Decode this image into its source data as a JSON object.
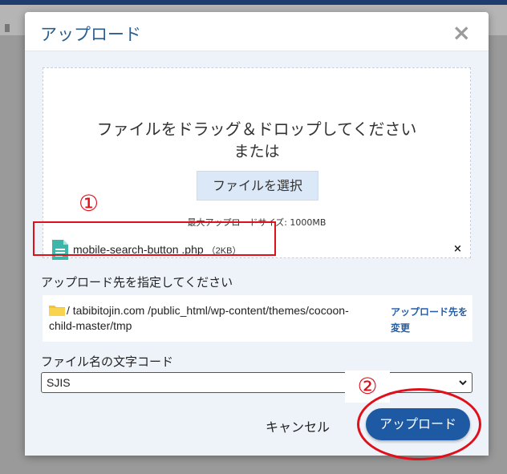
{
  "dialog": {
    "title": "アップロード",
    "close_symbol": "×"
  },
  "dropzone": {
    "instruction": "ファイルをドラッグ＆ドロップしてください",
    "or_text": "または",
    "select_button": "ファイルを選択",
    "max_size": "最大アップロードサイズ: 1000MB"
  },
  "file": {
    "name": "mobile-search-button .php",
    "size": "（2KB）",
    "remove_symbol": "×",
    "icon": "file-icon"
  },
  "destination": {
    "label": "アップロード先を指定してください",
    "path": "/ tabibitojin.com /public_html/wp-content/themes/cocoon-child-master/tmp",
    "change_link": "アップロード先を変更",
    "icon": "folder-icon"
  },
  "encoding": {
    "label": "ファイル名の文字コード",
    "selected": "SJIS"
  },
  "actions": {
    "cancel": "キャンセル",
    "upload": "アップロード"
  },
  "annotations": {
    "marker1": "①",
    "marker2": "②",
    "color": "#e0101a"
  },
  "colors": {
    "primary": "#1e5aa3",
    "title": "#2c5d8f",
    "body_bg": "#eef3fa",
    "select_button_bg": "#dbe8f7"
  }
}
